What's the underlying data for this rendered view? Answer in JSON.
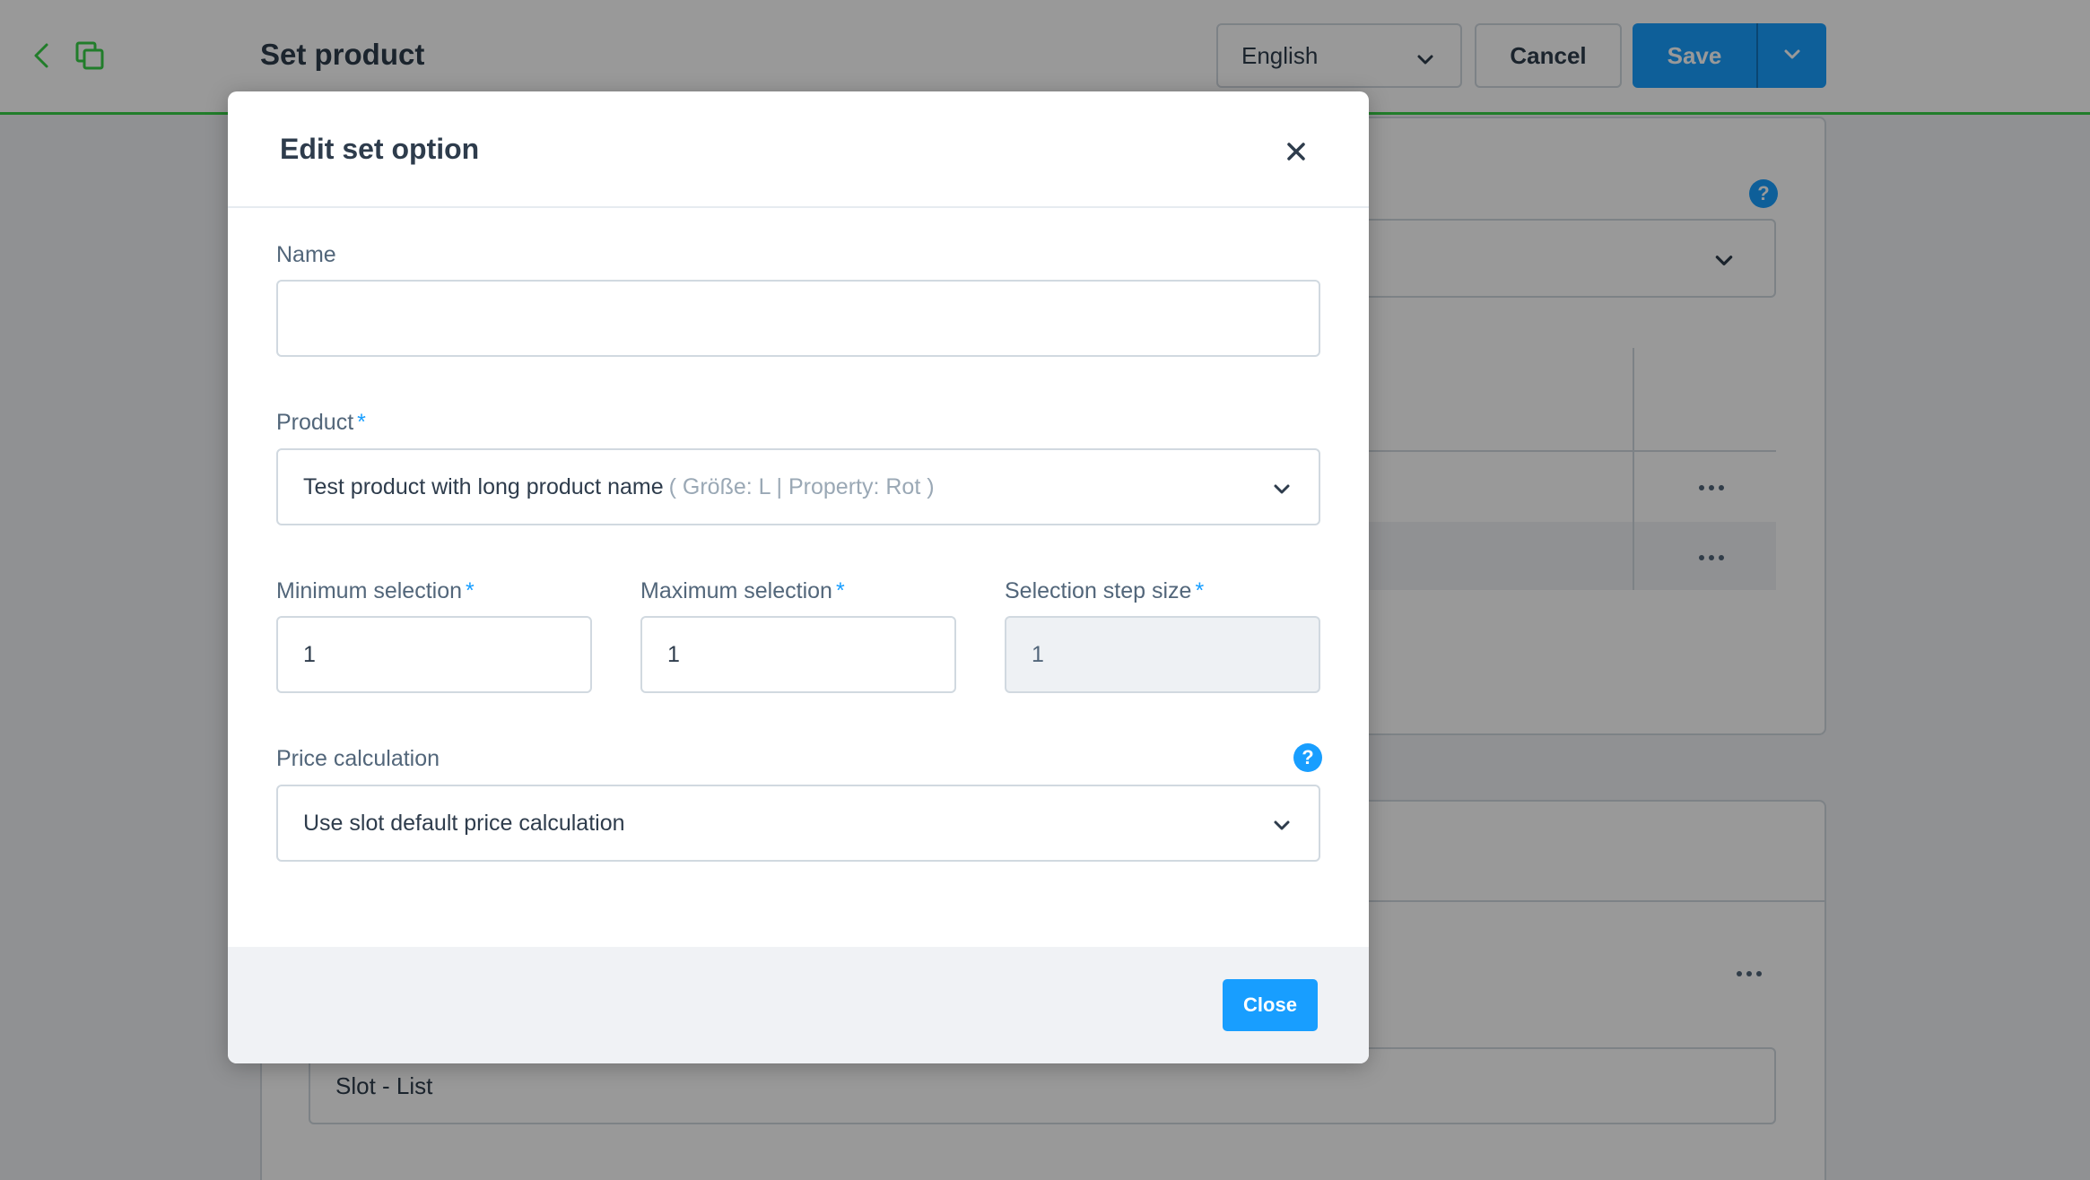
{
  "header": {
    "title": "Set product",
    "language": "English",
    "cancel_label": "Cancel",
    "save_label": "Save"
  },
  "background": {
    "help_glyph": "?",
    "slot_field_value": "Slot - List"
  },
  "modal": {
    "title": "Edit set option",
    "fields": {
      "name": {
        "label": "Name",
        "value": ""
      },
      "product": {
        "label": "Product",
        "required": "*",
        "value": "Test product with long product name",
        "variant": "( Größe: L | Property: Rot )"
      },
      "min_selection": {
        "label": "Minimum selection",
        "required": "*",
        "value": "1"
      },
      "max_selection": {
        "label": "Maximum selection",
        "required": "*",
        "value": "1"
      },
      "step_size": {
        "label": "Selection step size",
        "required": "*",
        "value": "1"
      },
      "price_calculation": {
        "label": "Price calculation",
        "value": "Use slot default price calculation",
        "help_glyph": "?"
      }
    },
    "close_label": "Close"
  },
  "colors": {
    "primary": "#189eff",
    "accent_line": "#37d046",
    "text_dark": "#2e3c4c",
    "text": "#52667a",
    "border": "#d1d9e0"
  },
  "icons": {
    "back": "chevron-left-icon",
    "copy": "copy-icon",
    "close": "close-icon",
    "dropdown": "chevron-down-icon",
    "help": "help-icon",
    "more": "more-icon"
  }
}
